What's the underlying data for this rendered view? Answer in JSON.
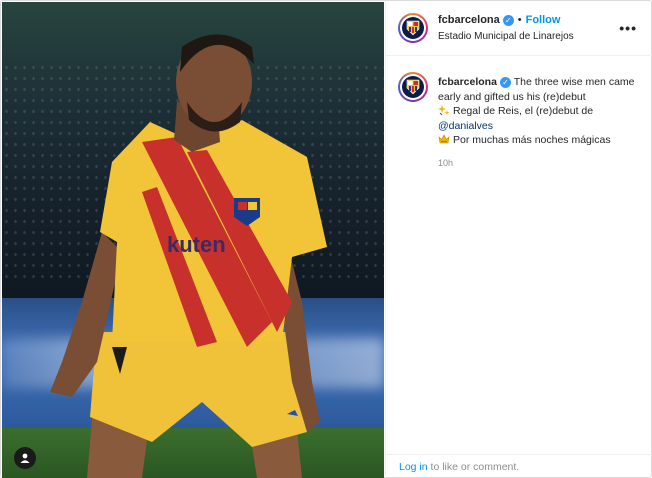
{
  "colors": {
    "follow": "#0095f6",
    "verified": "#3897f0",
    "mention": "#00376b",
    "muted": "#8e8e8e"
  },
  "post": {
    "username": "fcbarcelona",
    "follow_label": "Follow",
    "location": "Estadio Municipal de Linarejos",
    "caption": {
      "username": "fcbarcelona",
      "line1": "The three wise men came early and gifted us his (re)debut",
      "line2": "Regal de Reis, el (re)debut de",
      "mention": "@danialves",
      "line3": "Por muchas más noches mágicas"
    },
    "time": "10h"
  },
  "footer": {
    "login_link": "Log in",
    "login_text": " to like or comment."
  },
  "icons": {
    "more": "more-options-icon",
    "verified": "verified-badge-icon",
    "user": "user-tags-icon",
    "sparkle": "sparkle-emoji-icon",
    "crown": "crown-emoji-icon"
  }
}
